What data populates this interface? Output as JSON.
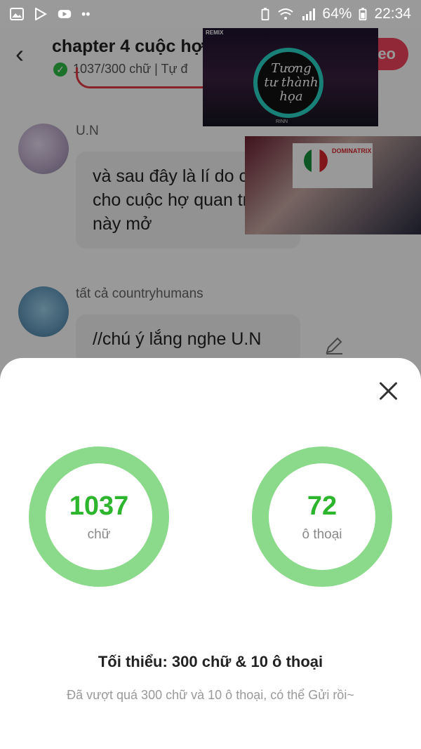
{
  "status_bar": {
    "battery": "64%",
    "time": "22:34",
    "left_icons": [
      "gallery-icon",
      "play-store-icon",
      "youtube-icon",
      "more-dots-icon"
    ],
    "right_icons": [
      "battery-saver-icon",
      "wifi-icon",
      "signal-icon",
      "battery-icon"
    ]
  },
  "header": {
    "title": "chapter 4 cuộc hợ",
    "subtitle": "1037/300 chữ | Tự đ",
    "video_button_label": "eo"
  },
  "messages": [
    {
      "author": "U.N",
      "text": "và sau đây là lí do chính cho cuộc hợ quan trọng này mở"
    },
    {
      "author": "tất cả countryhumans",
      "text": "//chú ý lắng nghe U.N"
    }
  ],
  "pip_videos": {
    "first": {
      "title": "Tương tư thành họa",
      "tag": "REMIX",
      "brand": "RINN"
    },
    "second": {
      "banner": "DOMINATRIX"
    }
  },
  "stats_sheet": {
    "words": {
      "value": "1037",
      "label": "chữ"
    },
    "dialogues": {
      "value": "72",
      "label": "ô thoại"
    },
    "requirement": "Tối thiểu: 300 chữ & 10 ô thoại",
    "note": "Đã vượt quá 300 chữ và 10 ô thoại, có thể Gửi rồi~"
  },
  "colors": {
    "ring": "#8bd98b",
    "number": "#2db52d",
    "accent_red": "#f0445c",
    "check_green": "#2fbf47"
  }
}
